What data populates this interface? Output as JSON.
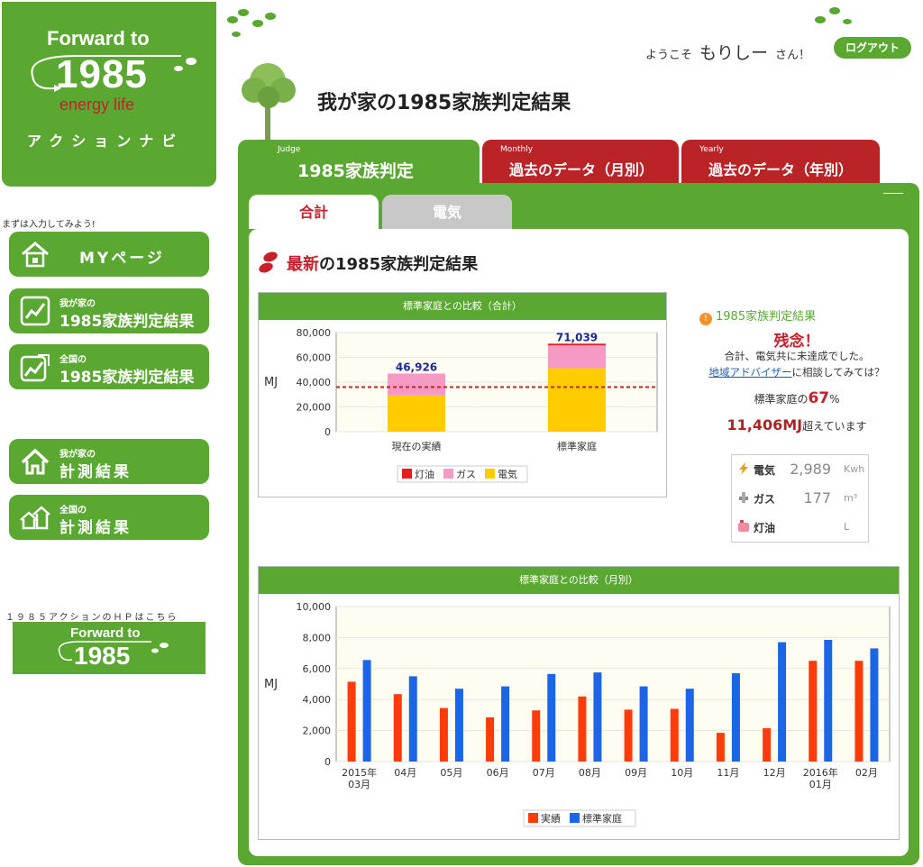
{
  "brand": {
    "forward_to": "Forward to",
    "year": "1985",
    "sub": "energy life",
    "navi": "アクションナビ"
  },
  "sidebar": {
    "note": "まずは入力してみよう!",
    "buttons": [
      {
        "single": "MYページ",
        "icon": "house-icon"
      },
      {
        "small": "我が家の",
        "big": "1985家族判定結果",
        "icon": "chart-up-icon"
      },
      {
        "small": "全国の",
        "big": "1985家族判定結果",
        "icon": "chart-up-multi-icon"
      },
      {
        "small": "我が家の",
        "big": "計測結果",
        "icon": "house-outline-icon"
      },
      {
        "small": "全国の",
        "big": "計測結果",
        "icon": "houses-icon"
      }
    ],
    "hp_note": "１９８５アクションのＨＰはこちら",
    "banner": {
      "forward_to": "Forward to",
      "year": "1985"
    }
  },
  "header": {
    "welcome_prefix": "ようこそ",
    "user_name": "もりしー",
    "welcome_suffix": "さん！",
    "logout": "ログアウト",
    "title": "我が家の1985家族判定結果"
  },
  "tabs": [
    {
      "en": "Judge",
      "label": "1985家族判定"
    },
    {
      "en": "Monthly",
      "label": "過去のデータ（月別）"
    },
    {
      "en": "Yearly",
      "label": "過去のデータ（年別）"
    }
  ],
  "subtabs": [
    {
      "label": "合計"
    },
    {
      "label": "電気"
    }
  ],
  "section_title": {
    "highlight": "最新",
    "rest": "の1985家族判定結果"
  },
  "result": {
    "heading": "1985家族判定結果",
    "sorry": "残念！",
    "msg_line1": "合計、電気共に未達成でした。",
    "advisor_link": "地域アドバイザー",
    "msg_line2_rest": "に相談してみては？",
    "pct_prefix": "標準家庭の",
    "pct_value": "67",
    "pct_suffix": "%",
    "over_value": "11,406MJ",
    "over_suffix": "超えています",
    "usage": [
      {
        "label": "電気",
        "value": "2,989",
        "unit": "Kwh",
        "color": "#5aa832"
      },
      {
        "label": "ガス",
        "value": "177",
        "unit": "m³",
        "color": "#888888"
      },
      {
        "label": "灯油",
        "value": "",
        "unit": "L",
        "color": "#f08aa0"
      }
    ]
  },
  "chart_data": [
    {
      "type": "bar",
      "title": "標準家庭との比較（合計）",
      "ylabel": "MJ",
      "ylim": [
        0,
        80000
      ],
      "yticks": [
        "0",
        "20,000",
        "40,000",
        "60,000",
        "80,000"
      ],
      "categories": [
        "現在の実績",
        "標準家庭"
      ],
      "stacked": true,
      "series": [
        {
          "name": "灯油",
          "color": "#e51d1d",
          "values": [
            0,
            1400
          ]
        },
        {
          "name": "ガス",
          "color": "#f59ac5",
          "values": [
            17700,
            18400
          ]
        },
        {
          "name": "電気",
          "color": "#ffcc00",
          "values": [
            29226,
            51239
          ]
        }
      ],
      "totals": [
        "46,926",
        "71,039"
      ],
      "reference_line": 36000
    },
    {
      "type": "bar",
      "title": "標準家庭との比較（月別）",
      "ylabel": "MJ",
      "ylim": [
        0,
        10000
      ],
      "yticks": [
        "0",
        "2,000",
        "4,000",
        "6,000",
        "8,000",
        "10,000"
      ],
      "categories": [
        "2015年\n03月",
        "04月",
        "05月",
        "06月",
        "07月",
        "08月",
        "09月",
        "10月",
        "11月",
        "12月",
        "2016年\n01月",
        "02月"
      ],
      "series": [
        {
          "name": "実績",
          "color": "#ff3b0a",
          "values": [
            5150,
            4350,
            3450,
            2850,
            3300,
            4200,
            3350,
            3400,
            1850,
            2150,
            6500,
            6500
          ]
        },
        {
          "name": "標準家庭",
          "color": "#1a66e6",
          "values": [
            6550,
            5500,
            4700,
            4850,
            5650,
            5750,
            4850,
            4700,
            5700,
            7700,
            7850,
            7300
          ]
        }
      ]
    }
  ]
}
